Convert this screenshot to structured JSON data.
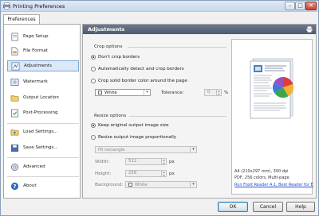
{
  "window": {
    "title": "Printing Preferences"
  },
  "tabs": {
    "preferences": "Preferences"
  },
  "sidebar": {
    "items": [
      {
        "label": "Page Setup",
        "icon": "page-setup-icon"
      },
      {
        "label": "File Format",
        "icon": "file-format-icon"
      },
      {
        "label": "Adjustments",
        "icon": "adjustments-icon",
        "active": true
      },
      {
        "label": "Watermark",
        "icon": "watermark-icon"
      },
      {
        "label": "Output Location",
        "icon": "output-location-icon"
      },
      {
        "label": "Post-Processing",
        "icon": "post-processing-icon"
      },
      {
        "label": "Load Settings...",
        "icon": "load-settings-icon"
      },
      {
        "label": "Save Settings...",
        "icon": "save-settings-icon"
      },
      {
        "label": "Advanced",
        "icon": "advanced-icon"
      },
      {
        "label": "About",
        "icon": "about-icon"
      }
    ]
  },
  "panel": {
    "header": "Adjustments",
    "crop": {
      "group_label": "Crop options",
      "dont_crop": "Don't crop borders",
      "auto_detect": "Automatically detect and crop borders",
      "crop_solid": "Crop solid border color around the page",
      "color_value": "White",
      "tolerance_label": "Tolerance:",
      "tolerance_value": "0",
      "tolerance_unit": "%",
      "selected": "dont_crop"
    },
    "resize": {
      "group_label": "Resize options",
      "keep_original": "Keep original output image size",
      "resize_proportionally": "Resize output image proportionally",
      "fit_mode": "Fit rectangle",
      "width_label": "Width:",
      "width_value": "512",
      "width_unit": "px",
      "height_label": "Height:",
      "height_value": "256",
      "height_unit": "px",
      "background_label": "Background:",
      "background_value": "White",
      "selected": "keep_original"
    },
    "preview": {
      "line1": "A4 (210x297 mm), 300 dpi",
      "line2": "PDF, 256 colors, Multi-page",
      "link": "Run Foxit Reader 4.1, Best Reader for E"
    }
  },
  "buttons": {
    "ok": "OK",
    "cancel": "Cancel",
    "help": "Help"
  },
  "colors": {
    "header_bg": "#5a677b",
    "active_item": "#dbe8f8",
    "link": "#1a4fd6",
    "close": "#c8412c"
  }
}
